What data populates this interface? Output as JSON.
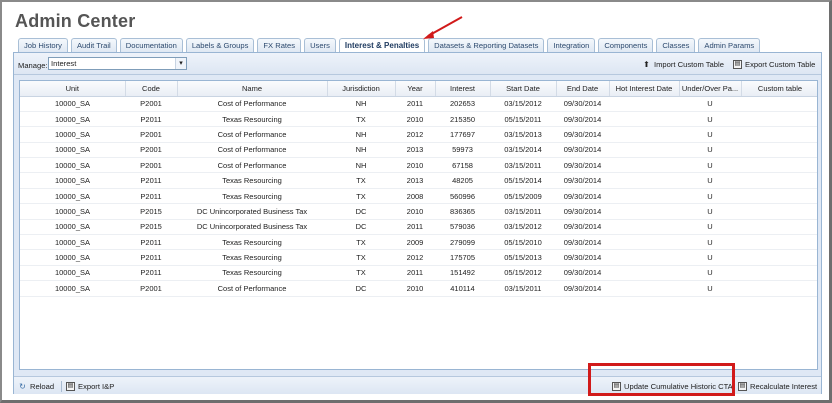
{
  "page": {
    "title": "Admin Center"
  },
  "tabs": [
    {
      "label": "Job History",
      "active": false
    },
    {
      "label": "Audit Trail",
      "active": false
    },
    {
      "label": "Documentation",
      "active": false
    },
    {
      "label": "Labels & Groups",
      "active": false
    },
    {
      "label": "FX Rates",
      "active": false
    },
    {
      "label": "Users",
      "active": false
    },
    {
      "label": "Interest & Penalties",
      "active": true
    },
    {
      "label": "Datasets & Reporting Datasets",
      "active": false
    },
    {
      "label": "Integration",
      "active": false
    },
    {
      "label": "Components",
      "active": false
    },
    {
      "label": "Classes",
      "active": false
    },
    {
      "label": "Admin Params",
      "active": false
    }
  ],
  "toolbar": {
    "manage_label": "Manage:",
    "manage_value": "Interest",
    "import_label": "Import Custom Table",
    "export_label": "Export Custom Table"
  },
  "table": {
    "columns": [
      "Unit",
      "Code",
      "Name",
      "Jurisdiction",
      "Year",
      "Interest",
      "Start Date",
      "End Date",
      "Hot Interest Date",
      "Under/Over Pa...",
      "Custom table"
    ],
    "rows": [
      [
        "10000_SA",
        "P2001",
        "Cost of Performance",
        "NH",
        "2011",
        "202653",
        "03/15/2012",
        "09/30/2014",
        "",
        "U",
        ""
      ],
      [
        "10000_SA",
        "P2011",
        "Texas Resourcing",
        "TX",
        "2010",
        "215350",
        "05/15/2011",
        "09/30/2014",
        "",
        "U",
        ""
      ],
      [
        "10000_SA",
        "P2001",
        "Cost of Performance",
        "NH",
        "2012",
        "177697",
        "03/15/2013",
        "09/30/2014",
        "",
        "U",
        ""
      ],
      [
        "10000_SA",
        "P2001",
        "Cost of Performance",
        "NH",
        "2013",
        "59973",
        "03/15/2014",
        "09/30/2014",
        "",
        "U",
        ""
      ],
      [
        "10000_SA",
        "P2001",
        "Cost of Performance",
        "NH",
        "2010",
        "67158",
        "03/15/2011",
        "09/30/2014",
        "",
        "U",
        ""
      ],
      [
        "10000_SA",
        "P2011",
        "Texas Resourcing",
        "TX",
        "2013",
        "48205",
        "05/15/2014",
        "09/30/2014",
        "",
        "U",
        ""
      ],
      [
        "10000_SA",
        "P2011",
        "Texas Resourcing",
        "TX",
        "2008",
        "560996",
        "05/15/2009",
        "09/30/2014",
        "",
        "U",
        ""
      ],
      [
        "10000_SA",
        "P2015",
        "DC Unincorporated Business Tax",
        "DC",
        "2010",
        "836365",
        "03/15/2011",
        "09/30/2014",
        "",
        "U",
        ""
      ],
      [
        "10000_SA",
        "P2015",
        "DC Unincorporated Business Tax",
        "DC",
        "2011",
        "579036",
        "03/15/2012",
        "09/30/2014",
        "",
        "U",
        ""
      ],
      [
        "10000_SA",
        "P2011",
        "Texas Resourcing",
        "TX",
        "2009",
        "279099",
        "05/15/2010",
        "09/30/2014",
        "",
        "U",
        ""
      ],
      [
        "10000_SA",
        "P2011",
        "Texas Resourcing",
        "TX",
        "2012",
        "175705",
        "05/15/2013",
        "09/30/2014",
        "",
        "U",
        ""
      ],
      [
        "10000_SA",
        "P2011",
        "Texas Resourcing",
        "TX",
        "2011",
        "151492",
        "05/15/2012",
        "09/30/2014",
        "",
        "U",
        ""
      ],
      [
        "10000_SA",
        "P2001",
        "Cost of Performance",
        "DC",
        "2010",
        "410114",
        "03/15/2011",
        "09/30/2014",
        "",
        "U",
        ""
      ]
    ]
  },
  "footer": {
    "reload_label": "Reload",
    "export_label": "Export I&P",
    "update_label": "Update Cumulative Historic CTA",
    "recalc_label": "Recalculate Interest"
  },
  "colors": {
    "highlight": "#d11a1a",
    "accent": "#99b5d3"
  },
  "icons": {
    "reload": "reload-icon",
    "export": "export-icon",
    "import": "import-icon",
    "export_table": "export-table-icon",
    "update": "calculator-icon",
    "recalc": "calculator-icon"
  }
}
